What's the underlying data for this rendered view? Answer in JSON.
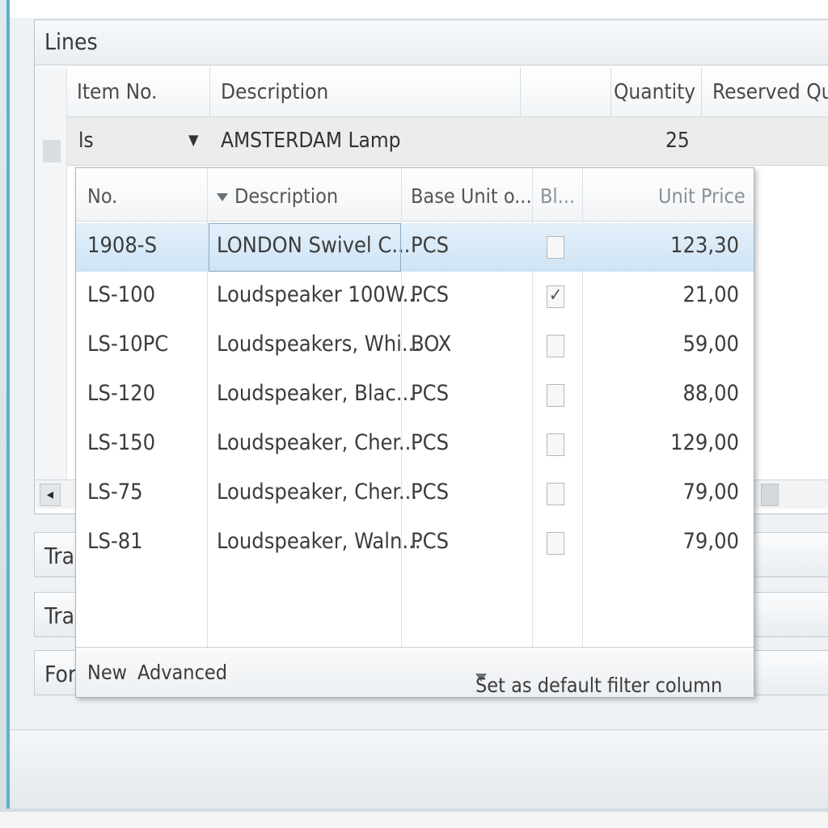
{
  "lines": {
    "title": "Lines",
    "columns": [
      "Item No.",
      "Description",
      "Quantity",
      "Reserved Qua..."
    ],
    "current_row": {
      "item_no": "ls",
      "description": "AMSTERDAM Lamp",
      "quantity": "25"
    }
  },
  "fasttabs": [
    "Tra",
    "Tra",
    "For"
  ],
  "lookup": {
    "columns": [
      "No.",
      "Description",
      "Base Unit o...",
      "Bl...",
      "Unit Price"
    ],
    "rows": [
      {
        "no": "1908-S",
        "description": "LONDON Swivel C...",
        "unit": "PCS",
        "checked": false,
        "price": "123,30"
      },
      {
        "no": "LS-100",
        "description": "Loudspeaker 100W...",
        "unit": "PCS",
        "checked": true,
        "price": "21,00"
      },
      {
        "no": "LS-10PC",
        "description": "Loudspeakers, Whi...",
        "unit": "BOX",
        "checked": false,
        "price": "59,00"
      },
      {
        "no": "LS-120",
        "description": "Loudspeaker, Blac...",
        "unit": "PCS",
        "checked": false,
        "price": "88,00"
      },
      {
        "no": "LS-150",
        "description": "Loudspeaker, Cher...",
        "unit": "PCS",
        "checked": false,
        "price": "129,00"
      },
      {
        "no": "LS-75",
        "description": "Loudspeaker, Cher...",
        "unit": "PCS",
        "checked": false,
        "price": "79,00"
      },
      {
        "no": "LS-81",
        "description": "Loudspeaker, Waln...",
        "unit": "PCS",
        "checked": false,
        "price": "79,00"
      }
    ],
    "footer": {
      "new_label": "New",
      "advanced_label": "Advanced",
      "default_filter_label": "Set as default filter column"
    }
  },
  "icons": {
    "dropdown_arrow": "chevron-down-icon",
    "filter": "filter-icon",
    "scroll_left": "arrow-left-icon"
  },
  "colors": {
    "window_border": "#5fb3c7",
    "selected_row": "#cfe4f5"
  }
}
